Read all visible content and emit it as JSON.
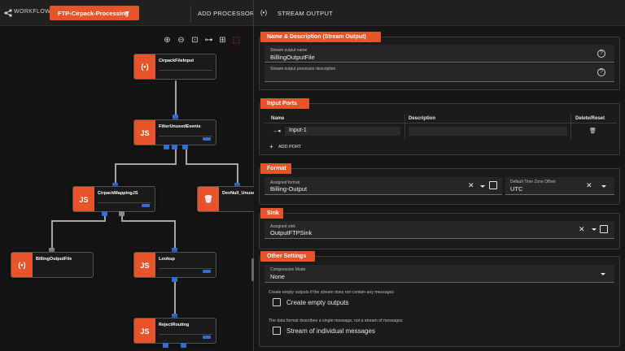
{
  "workflow": {
    "label": "WORKFLOW:",
    "selected": "FTP-Cirpack-Processing",
    "add_processor": "ADD PROCESSOR"
  },
  "canvas": {
    "nodes": [
      {
        "id": "n1",
        "name": "CirpackFileInput",
        "icon": "broadcast-icon"
      },
      {
        "id": "n2",
        "name": "FilterUnusedEvents",
        "icon": "js-icon"
      },
      {
        "id": "n3",
        "name": "CirpackMappingJS",
        "icon": "js-icon"
      },
      {
        "id": "n4",
        "name": "DevNull_Unuse",
        "icon": "trash-icon"
      },
      {
        "id": "n5",
        "name": "BillingOutputFile",
        "icon": "broadcast-icon"
      },
      {
        "id": "n6",
        "name": "Lookup",
        "icon": "js-icon"
      },
      {
        "id": "n7",
        "name": "RejectRouting",
        "icon": "js-icon"
      }
    ]
  },
  "panel": {
    "title": "STREAM OUTPUT",
    "name_section": {
      "title": "Name & Description (Stream Output)",
      "name_label": "Stream output name",
      "name_value": "BillingOutputFile",
      "desc_label": "Stream output processor description",
      "desc_value": ""
    },
    "input_ports": {
      "title": "Input Ports",
      "columns": [
        "Name",
        "Description",
        "Delete/Reset"
      ],
      "rows": [
        {
          "name": "Input-1",
          "description": ""
        }
      ],
      "add_label": "ADD PORT"
    },
    "format": {
      "title": "Format",
      "assigned_label": "Assigned format",
      "assigned_value": "Billing-Output",
      "tz_label": "Default Time Zone Offset",
      "tz_value": "UTC"
    },
    "sink": {
      "title": "Sink",
      "assigned_label": "Assigned sink",
      "assigned_value": "OutputFTPSink"
    },
    "other": {
      "title": "Other Settings",
      "compression_label": "Compression Mode",
      "compression_value": "None",
      "empty_help": "Create empty outputs if the stream does not contain any messages",
      "empty_label": "Create empty outputs",
      "stream_help": "The data format describes a single message, not a stream of messages",
      "stream_label": "Stream of individual messages"
    }
  },
  "colors": {
    "accent": "#e8542a",
    "port": "#2f6fd6",
    "background": "#161616"
  }
}
